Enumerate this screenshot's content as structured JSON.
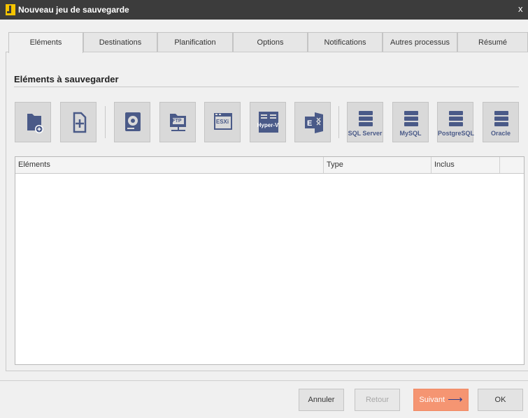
{
  "window": {
    "title": "Nouveau jeu de sauvegarde",
    "close_glyph": "x"
  },
  "tabs": [
    {
      "label": "Eléments",
      "active": true
    },
    {
      "label": "Destinations"
    },
    {
      "label": "Planification"
    },
    {
      "label": "Options"
    },
    {
      "label": "Notifications"
    },
    {
      "label": "Autres processus"
    },
    {
      "label": "Résumé"
    }
  ],
  "section": {
    "title": "Eléments à sauvegarder"
  },
  "toolbar": {
    "buttons": [
      {
        "icon": "folder-add-icon"
      },
      {
        "icon": "file-add-icon"
      },
      {
        "icon": "disk-drive-icon"
      },
      {
        "icon": "ftp-folder-icon",
        "label": "FTP"
      },
      {
        "icon": "esxi-icon",
        "label": "ESXi"
      },
      {
        "icon": "hyper-v-icon",
        "label": "Hyper-V"
      },
      {
        "icon": "exchange-icon"
      },
      {
        "icon": "database-icon",
        "label": "SQL Server"
      },
      {
        "icon": "database-icon",
        "label": "MySQL"
      },
      {
        "icon": "database-icon",
        "label": "PostgreSQL"
      },
      {
        "icon": "database-icon",
        "label": "Oracle"
      }
    ]
  },
  "table": {
    "columns": [
      "Eléments",
      "Type",
      "Inclus",
      ""
    ],
    "rows": []
  },
  "footer": {
    "cancel": "Annuler",
    "back": "Retour",
    "next": "Suivant",
    "ok": "OK"
  },
  "colors": {
    "titlebar": "#3c3c3c",
    "accent": "#f59572",
    "icon": "#4a5a88",
    "app_icon": "#f5c400"
  }
}
